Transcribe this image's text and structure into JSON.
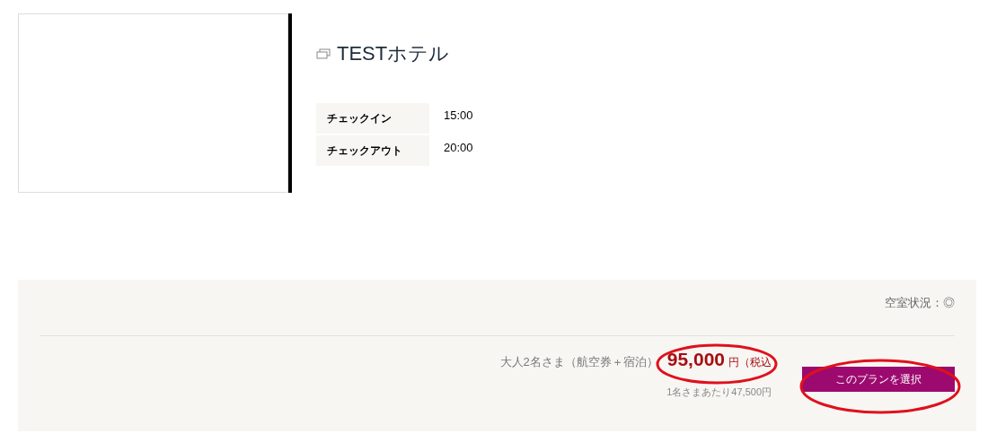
{
  "hotel": {
    "name": "TESTホテル",
    "times": [
      {
        "label": "チェックイン",
        "value": "15:00"
      },
      {
        "label": "チェックアウト",
        "value": "20:00"
      }
    ]
  },
  "plan": {
    "availability": "空室状況：◎",
    "guests": "大人2名さま（航空券＋宿泊）",
    "price": "95,000",
    "currency": "円",
    "tax": "（税込",
    "per_person": "1名さまあたり47,500円",
    "button": "このプランを選択"
  }
}
